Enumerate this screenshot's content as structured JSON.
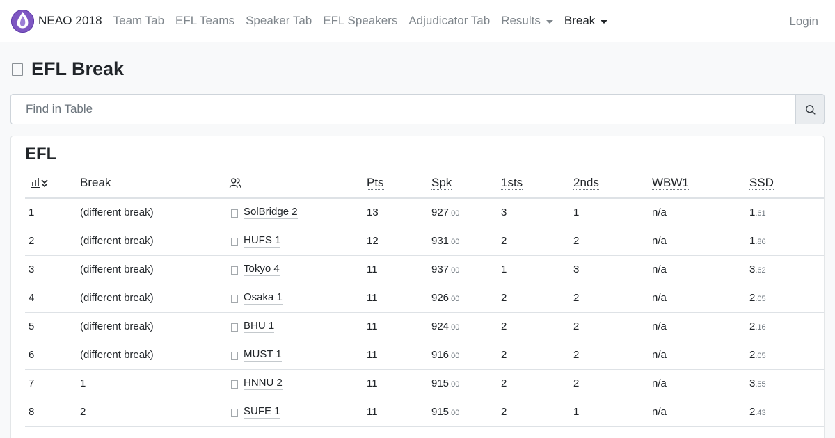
{
  "nav": {
    "brand": "NEAO 2018",
    "items": [
      {
        "label": "Team Tab",
        "name": "nav-team-tab",
        "dropdown": false,
        "active": false
      },
      {
        "label": "EFL Teams",
        "name": "nav-efl-teams",
        "dropdown": false,
        "active": false
      },
      {
        "label": "Speaker Tab",
        "name": "nav-speaker-tab",
        "dropdown": false,
        "active": false
      },
      {
        "label": "EFL Speakers",
        "name": "nav-efl-speakers",
        "dropdown": false,
        "active": false
      },
      {
        "label": "Adjudicator Tab",
        "name": "nav-adjudicator-tab",
        "dropdown": false,
        "active": false
      },
      {
        "label": "Results",
        "name": "nav-results",
        "dropdown": true,
        "active": false
      },
      {
        "label": "Break",
        "name": "nav-break",
        "dropdown": true,
        "active": true
      }
    ],
    "login": "Login"
  },
  "page": {
    "title": "EFL Break"
  },
  "search": {
    "placeholder": "Find in Table"
  },
  "card": {
    "title": "EFL",
    "columns": [
      "",
      "Break",
      "",
      "Pts",
      "Spk",
      "1sts",
      "2nds",
      "WBW1",
      "SSD"
    ],
    "rows": [
      {
        "rank": "1",
        "brk": "(different break)",
        "team": "SolBridge 2",
        "pts": "13",
        "spk_int": "927",
        "spk_dec": ".00",
        "firsts": "3",
        "seconds": "1",
        "wbw": "n/a",
        "ssd_int": "1",
        "ssd_dec": ".61"
      },
      {
        "rank": "2",
        "brk": "(different break)",
        "team": "HUFS 1",
        "pts": "12",
        "spk_int": "931",
        "spk_dec": ".00",
        "firsts": "2",
        "seconds": "2",
        "wbw": "n/a",
        "ssd_int": "1",
        "ssd_dec": ".86"
      },
      {
        "rank": "3",
        "brk": "(different break)",
        "team": "Tokyo 4",
        "pts": "11",
        "spk_int": "937",
        "spk_dec": ".00",
        "firsts": "1",
        "seconds": "3",
        "wbw": "n/a",
        "ssd_int": "3",
        "ssd_dec": ".62"
      },
      {
        "rank": "4",
        "brk": "(different break)",
        "team": "Osaka 1",
        "pts": "11",
        "spk_int": "926",
        "spk_dec": ".00",
        "firsts": "2",
        "seconds": "2",
        "wbw": "n/a",
        "ssd_int": "2",
        "ssd_dec": ".05"
      },
      {
        "rank": "5",
        "brk": "(different break)",
        "team": "BHU 1",
        "pts": "11",
        "spk_int": "924",
        "spk_dec": ".00",
        "firsts": "2",
        "seconds": "2",
        "wbw": "n/a",
        "ssd_int": "2",
        "ssd_dec": ".16"
      },
      {
        "rank": "6",
        "brk": "(different break)",
        "team": "MUST 1",
        "pts": "11",
        "spk_int": "916",
        "spk_dec": ".00",
        "firsts": "2",
        "seconds": "2",
        "wbw": "n/a",
        "ssd_int": "2",
        "ssd_dec": ".05"
      },
      {
        "rank": "7",
        "brk": "1",
        "team": "HNNU 2",
        "pts": "11",
        "spk_int": "915",
        "spk_dec": ".00",
        "firsts": "2",
        "seconds": "2",
        "wbw": "n/a",
        "ssd_int": "3",
        "ssd_dec": ".55"
      },
      {
        "rank": "8",
        "brk": "2",
        "team": "SUFE 1",
        "pts": "11",
        "spk_int": "915",
        "spk_dec": ".00",
        "firsts": "2",
        "seconds": "1",
        "wbw": "n/a",
        "ssd_int": "2",
        "ssd_dec": ".43"
      }
    ]
  },
  "colors": {
    "text": "#212529",
    "muted": "#7f868c",
    "border": "#dee2e6",
    "background": "#f8f9fa",
    "logo": "#7e57c2"
  },
  "icons": {
    "logo": "tabbycat-logo-icon",
    "title": "award-icon",
    "search": "search-icon",
    "rank_sort": "ranking-sort-icon",
    "team_header": "users-icon",
    "team_row": "team-icon"
  }
}
